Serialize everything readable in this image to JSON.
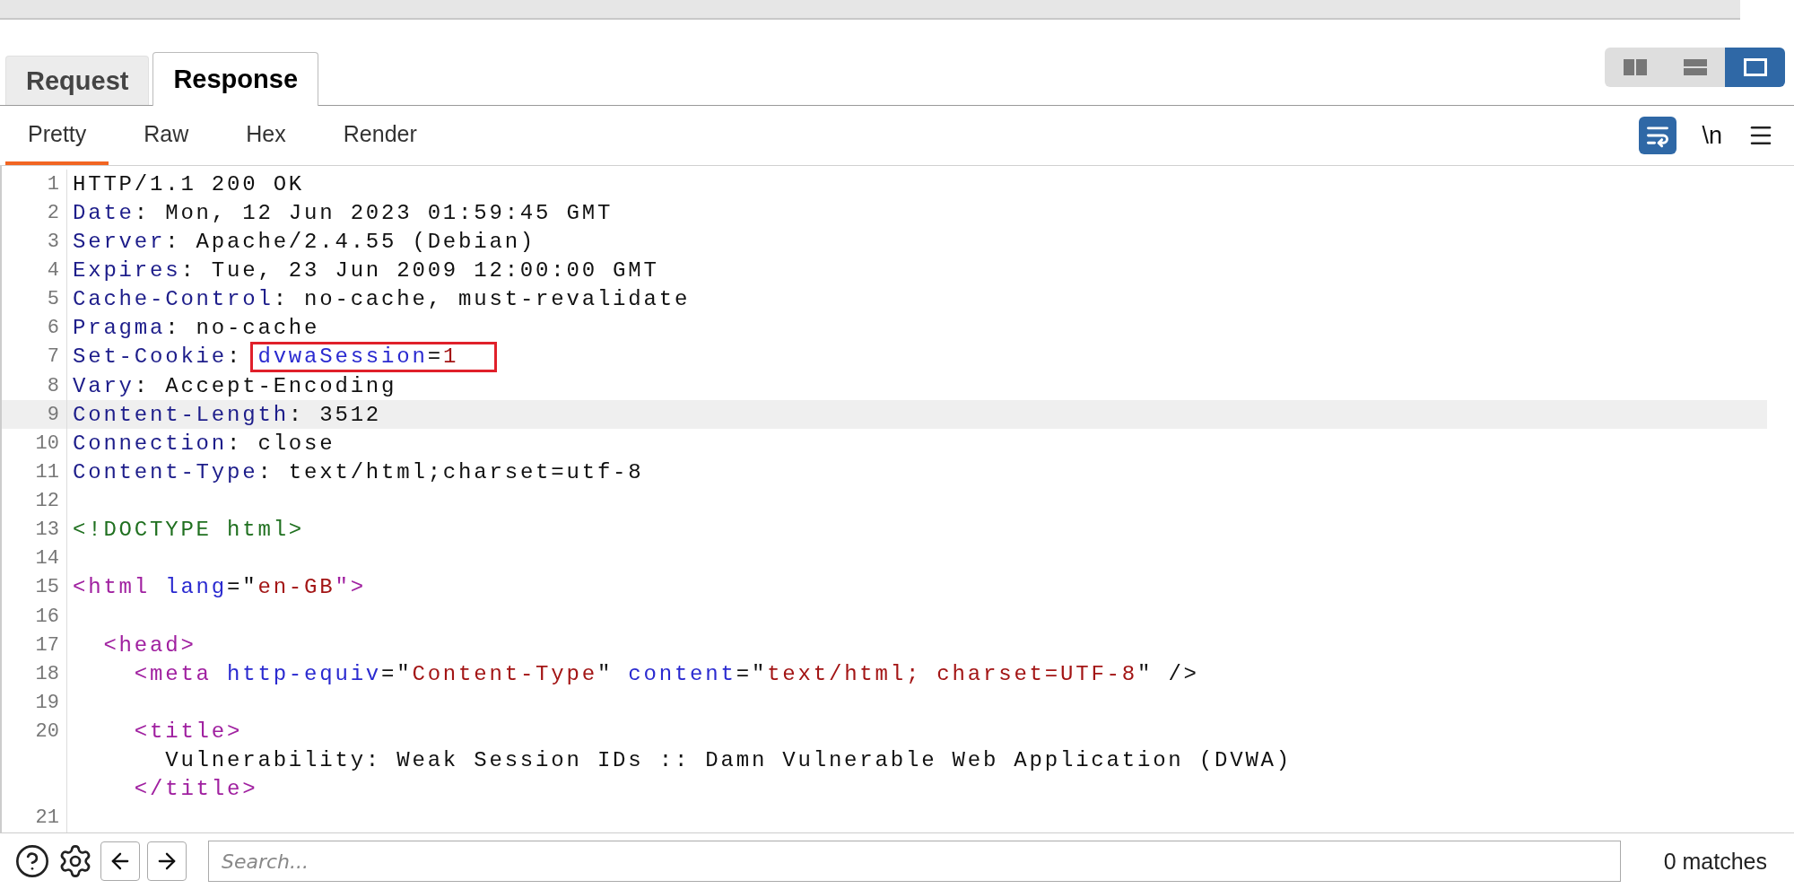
{
  "tabs": [
    {
      "label": "Request",
      "selected": false
    },
    {
      "label": "Response",
      "selected": true
    }
  ],
  "layout_buttons": [
    {
      "kind": "side-by-side",
      "selected": false
    },
    {
      "kind": "stacked",
      "selected": false
    },
    {
      "kind": "single",
      "selected": true
    }
  ],
  "view_tabs": [
    {
      "label": "Pretty",
      "selected": true
    },
    {
      "label": "Raw",
      "selected": false
    },
    {
      "label": "Hex",
      "selected": false
    },
    {
      "label": "Render",
      "selected": false
    }
  ],
  "toolbar": {
    "wrap_on": true,
    "newline_label": "\\n"
  },
  "lines": [
    {
      "number": "1",
      "selected": false,
      "segments": [
        {
          "text": "HTTP/1.1 200 OK",
          "kind": "plain"
        }
      ]
    },
    {
      "number": "2",
      "selected": false,
      "segments": [
        {
          "text": "Date",
          "kind": "name"
        },
        {
          "text": ": Mon, 12 Jun 2023 01:59:45 GMT",
          "kind": "plain"
        }
      ]
    },
    {
      "number": "3",
      "selected": false,
      "segments": [
        {
          "text": "Server",
          "kind": "name"
        },
        {
          "text": ": Apache/2.4.55 (Debian)",
          "kind": "plain"
        }
      ]
    },
    {
      "number": "4",
      "selected": false,
      "segments": [
        {
          "text": "Expires",
          "kind": "name"
        },
        {
          "text": ": Tue, 23 Jun 2009 12:00:00 GMT",
          "kind": "plain"
        }
      ]
    },
    {
      "number": "5",
      "selected": false,
      "segments": [
        {
          "text": "Cache-Control",
          "kind": "name"
        },
        {
          "text": ": no-cache, must-revalidate",
          "kind": "plain"
        }
      ]
    },
    {
      "number": "6",
      "selected": false,
      "segments": [
        {
          "text": "Pragma",
          "kind": "name"
        },
        {
          "text": ": no-cache",
          "kind": "plain"
        }
      ]
    },
    {
      "number": "7",
      "selected": false,
      "segments": [
        {
          "text": "Set-Cookie",
          "kind": "name"
        },
        {
          "text": ": ",
          "kind": "plain"
        },
        {
          "text": "dvwaSession",
          "kind": "attr",
          "boxed": true
        },
        {
          "text": "=",
          "kind": "plain",
          "boxed": true
        },
        {
          "text": "1",
          "kind": "value",
          "boxed": true
        }
      ]
    },
    {
      "number": "8",
      "selected": false,
      "segments": [
        {
          "text": "Vary",
          "kind": "name"
        },
        {
          "text": ": Accept-Encoding",
          "kind": "plain"
        }
      ]
    },
    {
      "number": "9",
      "selected": true,
      "segments": [
        {
          "text": "Content-Length",
          "kind": "name"
        },
        {
          "text": ": 3512",
          "kind": "plain"
        }
      ]
    },
    {
      "number": "10",
      "selected": false,
      "segments": [
        {
          "text": "Connection",
          "kind": "name"
        },
        {
          "text": ": close",
          "kind": "plain"
        }
      ]
    },
    {
      "number": "11",
      "selected": false,
      "segments": [
        {
          "text": "Content-Type",
          "kind": "name"
        },
        {
          "text": ": text/html;charset=utf-8",
          "kind": "plain"
        }
      ]
    },
    {
      "number": "12",
      "selected": false
    },
    {
      "number": "13",
      "selected": false,
      "segments": [
        {
          "text": "<!DOCTYPE html>",
          "kind": "doctype"
        }
      ]
    },
    {
      "number": "14",
      "selected": false
    },
    {
      "number": "15",
      "selected": false,
      "segments": [
        {
          "text": "<html ",
          "kind": "tag"
        },
        {
          "text": "lang",
          "kind": "attr"
        },
        {
          "text": "=\"",
          "kind": "plain"
        },
        {
          "text": "en-GB",
          "kind": "value"
        },
        {
          "text": "\">",
          "kind": "tag"
        }
      ]
    },
    {
      "number": "16",
      "selected": false
    },
    {
      "number": "17",
      "selected": false,
      "segments": [
        {
          "text": "  <head>",
          "kind": "tag"
        }
      ]
    },
    {
      "number": "18",
      "selected": false,
      "segments": [
        {
          "text": "    <meta ",
          "kind": "tag"
        },
        {
          "text": "http-equiv",
          "kind": "attr"
        },
        {
          "text": "=\"",
          "kind": "plain"
        },
        {
          "text": "Content-Type",
          "kind": "value"
        },
        {
          "text": "\" ",
          "kind": "plain"
        },
        {
          "text": "content",
          "kind": "attr"
        },
        {
          "text": "=\"",
          "kind": "plain"
        },
        {
          "text": "text/html; charset=UTF-8",
          "kind": "value"
        },
        {
          "text": "\" />",
          "kind": "plain"
        }
      ]
    },
    {
      "number": "19",
      "selected": false
    },
    {
      "number": "20",
      "selected": false,
      "segments": [
        {
          "text": "    <title>",
          "kind": "tag"
        }
      ],
      "continuation": [
        [
          {
            "text": "      Vulnerability: Weak Session IDs :: Damn Vulnerable Web Application (DVWA)",
            "kind": "plain"
          }
        ],
        [
          {
            "text": "    </title>",
            "kind": "tag"
          }
        ]
      ]
    },
    {
      "number": "21",
      "selected": false
    }
  ],
  "search": {
    "placeholder": "Search..."
  },
  "match_count": "0 matches"
}
